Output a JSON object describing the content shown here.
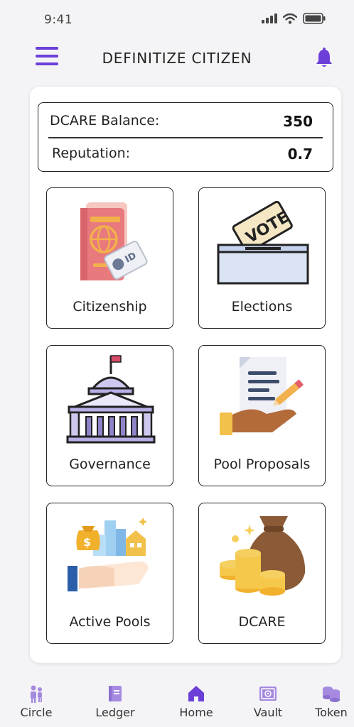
{
  "status_bar": {
    "time": "9:41"
  },
  "header": {
    "title": "DEFINITIZE CITIZEN"
  },
  "stats": {
    "balance_label": "DCARE Balance:",
    "balance_value": "350",
    "reputation_label": "Reputation:",
    "reputation_value": "0.7"
  },
  "tiles": [
    {
      "label": "Citizenship",
      "icon": "passport-icon"
    },
    {
      "label": "Elections",
      "icon": "ballot-box-icon"
    },
    {
      "label": "Governance",
      "icon": "capitol-building-icon"
    },
    {
      "label": "Pool Proposals",
      "icon": "document-proposal-icon"
    },
    {
      "label": "Active Pools",
      "icon": "money-city-hand-icon"
    },
    {
      "label": "DCARE",
      "icon": "money-bag-coins-icon"
    }
  ],
  "nav": [
    {
      "label": "Circle",
      "icon": "people-icon"
    },
    {
      "label": "Ledger",
      "icon": "book-icon"
    },
    {
      "label": "Home",
      "icon": "home-icon"
    },
    {
      "label": "Vault",
      "icon": "vault-icon"
    },
    {
      "label": "Token",
      "icon": "coins-icon"
    }
  ],
  "colors": {
    "accent": "#6c3fd9",
    "nav_icon": "#a58ae0"
  }
}
